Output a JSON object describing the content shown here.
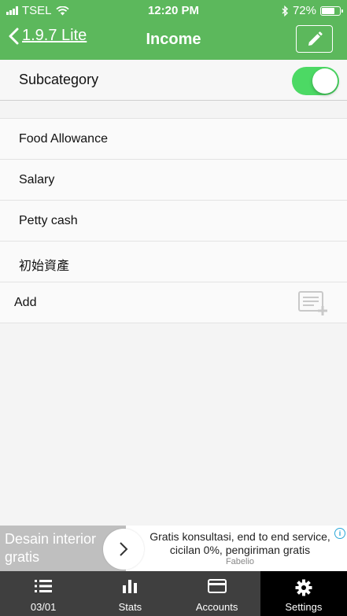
{
  "status_bar": {
    "carrier": "TSEL",
    "time": "12:20 PM",
    "battery": "72%",
    "battery_level": 0.72
  },
  "nav": {
    "back_label": "1.9.7 Lite",
    "title": "Income",
    "edit_icon": "pencil-icon"
  },
  "subcategory": {
    "label": "Subcategory",
    "enabled": true
  },
  "items": [
    {
      "label": "Food Allowance"
    },
    {
      "label": "Salary"
    },
    {
      "label": "Petty cash"
    },
    {
      "label": "初始資產"
    }
  ],
  "add_row": {
    "label": "Add",
    "icon": "add-list-icon"
  },
  "ad": {
    "left_text": "Desain interior gratis",
    "text": "Gratis konsultasi, end to end service, cicilan 0%, pengiriman gratis",
    "brand": "Fabelio"
  },
  "tabs": [
    {
      "label": "03/01",
      "icon": "list-icon"
    },
    {
      "label": "Stats",
      "icon": "bar-chart-icon"
    },
    {
      "label": "Accounts",
      "icon": "credit-card-icon"
    },
    {
      "label": "Settings",
      "icon": "gear-icon",
      "active": true
    }
  ],
  "colors": {
    "header": "#5cb85c",
    "toggle": "#4cd964",
    "tabbar": "#3f3f3f",
    "tab_active": "#000000"
  }
}
